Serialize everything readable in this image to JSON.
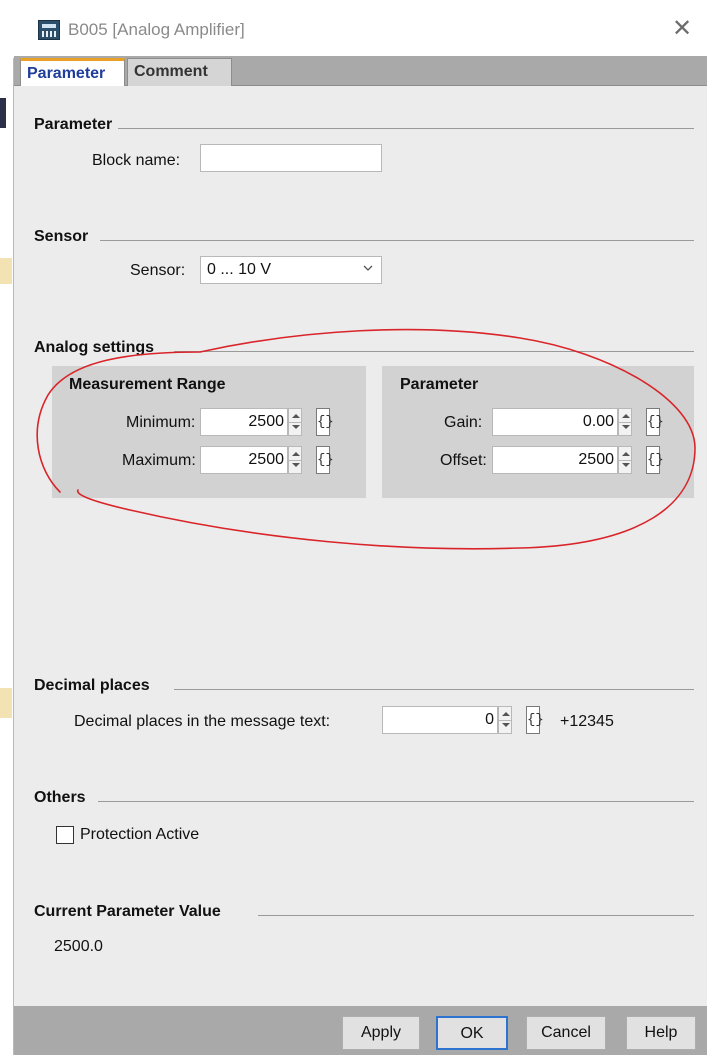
{
  "window": {
    "title": "B005 [Analog Amplifier]",
    "close_glyph": "✕"
  },
  "tabs": [
    {
      "label": "Parameter",
      "active": true
    },
    {
      "label": "Comment",
      "active": false
    }
  ],
  "sections": {
    "parameter": {
      "title": "Parameter",
      "block_name_label": "Block name:",
      "block_name_value": ""
    },
    "sensor": {
      "title": "Sensor",
      "sensor_label": "Sensor:",
      "sensor_value": "0 ... 10 V"
    },
    "analog_settings": {
      "title": "Analog settings",
      "measurement_range": {
        "title": "Measurement Range",
        "minimum_label": "Minimum:",
        "minimum_value": "2500",
        "maximum_label": "Maximum:",
        "maximum_value": "2500"
      },
      "parameter_group": {
        "title": "Parameter",
        "gain_label": "Gain:",
        "gain_value": "0.00",
        "offset_label": "Offset:",
        "offset_value": "2500"
      }
    },
    "decimal_places": {
      "title": "Decimal places",
      "label": "Decimal places in the message text:",
      "value": "0",
      "preview": "+12345"
    },
    "others": {
      "title": "Others",
      "protection_label": "Protection Active",
      "protection_checked": false
    },
    "current_value": {
      "title": "Current Parameter Value",
      "value": "2500.0"
    }
  },
  "buttons": {
    "apply": "Apply",
    "ok": "OK",
    "cancel": "Cancel",
    "help": "Help"
  },
  "brace_glyph": "{}",
  "colors": {
    "panel_bg": "#ececec",
    "group_bg": "#d2d2d2",
    "active_tab_text": "#1f3d9b",
    "active_tab_accent": "#e8a126",
    "annotation_red": "#d9252a",
    "ok_border": "#2f73d0"
  },
  "icons": [
    "app-icon",
    "close-icon",
    "chevron-down-icon",
    "spinner-icon",
    "brace-icon",
    "checkbox-icon"
  ]
}
